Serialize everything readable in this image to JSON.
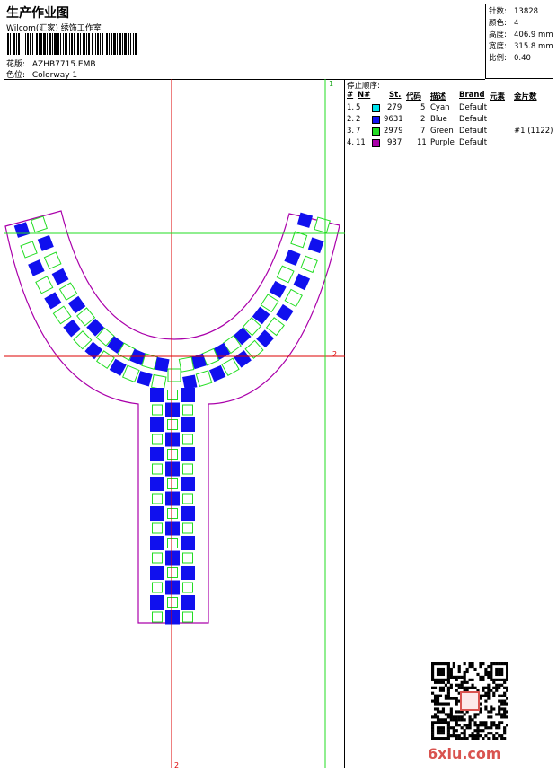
{
  "header": {
    "title": "生产作业图",
    "company": "Wilcom(汇家) 绣饰工作室",
    "design_label": "花版:",
    "design_value": "AZHB7715.EMB",
    "colorway_label": "色位:",
    "colorway_value": "Colorway 1"
  },
  "stats": [
    {
      "label": "针数:",
      "value": "13828"
    },
    {
      "label": "颜色:",
      "value": "4"
    },
    {
      "label": "高度:",
      "value": "406.9 mm"
    },
    {
      "label": "宽度:",
      "value": "315.8 mm"
    },
    {
      "label": "比例:",
      "value": "0.40"
    }
  ],
  "stop_sequence": {
    "title": "停止顺序:",
    "columns": [
      "#",
      "N#",
      "St.",
      "代码",
      "描述",
      "Brand",
      "元素",
      "金片数"
    ],
    "rows": [
      {
        "idx": "1.",
        "n": "5",
        "color": "#00e5ee",
        "st": "279",
        "code": "5",
        "desc": "Cyan",
        "brand": "Default",
        "element": "",
        "sequins": ""
      },
      {
        "idx": "2.",
        "n": "2",
        "color": "#1010ee",
        "st": "9631",
        "code": "2",
        "desc": "Blue",
        "brand": "Default",
        "element": "",
        "sequins": ""
      },
      {
        "idx": "3.",
        "n": "7",
        "color": "#22dd22",
        "st": "2979",
        "code": "7",
        "desc": "Green",
        "brand": "Default",
        "element": "",
        "sequins": "#1 (1122)"
      },
      {
        "idx": "4.",
        "n": "11",
        "color": "#aa00aa",
        "st": "937",
        "code": "11",
        "desc": "Purple",
        "brand": "Default",
        "element": "",
        "sequins": ""
      }
    ]
  },
  "guides": {
    "v1": "1",
    "h2": "2",
    "v2": "2"
  },
  "watermark": "6xiu.com",
  "colors": {
    "blue": "#1010ee",
    "green": "#22dd22",
    "purple": "#aa00aa",
    "red": "#dd0000"
  }
}
